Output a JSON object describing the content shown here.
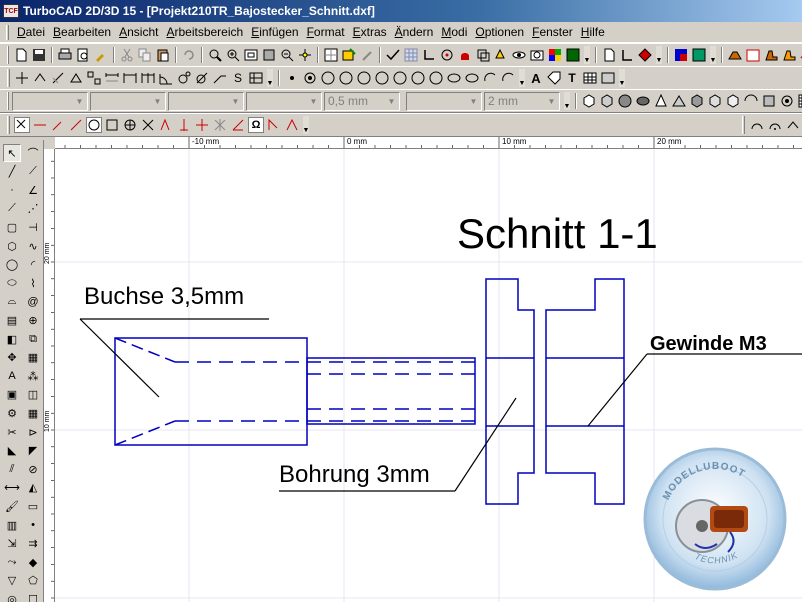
{
  "window": {
    "title": "TurboCAD 2D/3D 15 - [Projekt210TR_Bajostecker_Schnitt.dxf]",
    "app_icon_text": "TCF"
  },
  "menu": {
    "items": [
      "Datei",
      "Bearbeiten",
      "Ansicht",
      "Arbeitsbereich",
      "Einfügen",
      "Format",
      "Extras",
      "Ändern",
      "Modi",
      "Optionen",
      "Fenster",
      "Hilfe"
    ]
  },
  "property_bar": {
    "line_width": "0,5 mm",
    "spacing": "2 mm"
  },
  "ruler": {
    "top_labels": [
      "-10 mm",
      "0 mm",
      "10 mm",
      "20 mm"
    ],
    "left_labels": [
      "20 mm",
      "10 mm"
    ]
  },
  "drawing": {
    "title": "Schnitt 1-1",
    "label_buchse": "Buchse 3,5mm",
    "label_bohrung": "Bohrung 3mm",
    "label_gewinde": "Gewinde M3",
    "line_color": "#0000c0",
    "leader_color": "#000000"
  },
  "watermark": {
    "top_text": "MODELLUBOOT",
    "bottom_text": "TECHNIK"
  }
}
